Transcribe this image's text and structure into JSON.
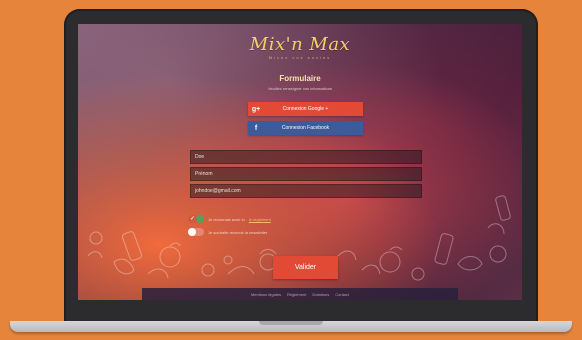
{
  "brand": {
    "name": "Mix'n Max",
    "tagline": "Mixez vos envies"
  },
  "form": {
    "title": "Formulaire",
    "subtitle": "Veuillez renseigner vos informations",
    "google_button": {
      "icon": "g+",
      "label": "Connexion Google +"
    },
    "facebook_button": {
      "icon": "f",
      "label": "Connexion Facebook"
    },
    "fields": {
      "name": "Doe",
      "firstname": "Prénom",
      "email": "johndoe@gmail.com"
    },
    "toggles": {
      "rules": {
        "state": "on",
        "text": "Je reconnais avoir lu",
        "link": "le règlement"
      },
      "newsletter": {
        "state": "off",
        "text": "Je souhaite recevoir la newsletter"
      }
    },
    "submit": "Valider"
  },
  "footer": {
    "links": [
      "Mentions légales",
      "Règlement",
      "Dotations",
      "Contact"
    ]
  },
  "colors": {
    "background": "#e6843c",
    "google": "#e24a36",
    "facebook": "#3c5b9a",
    "accent": "#f4d06a"
  }
}
